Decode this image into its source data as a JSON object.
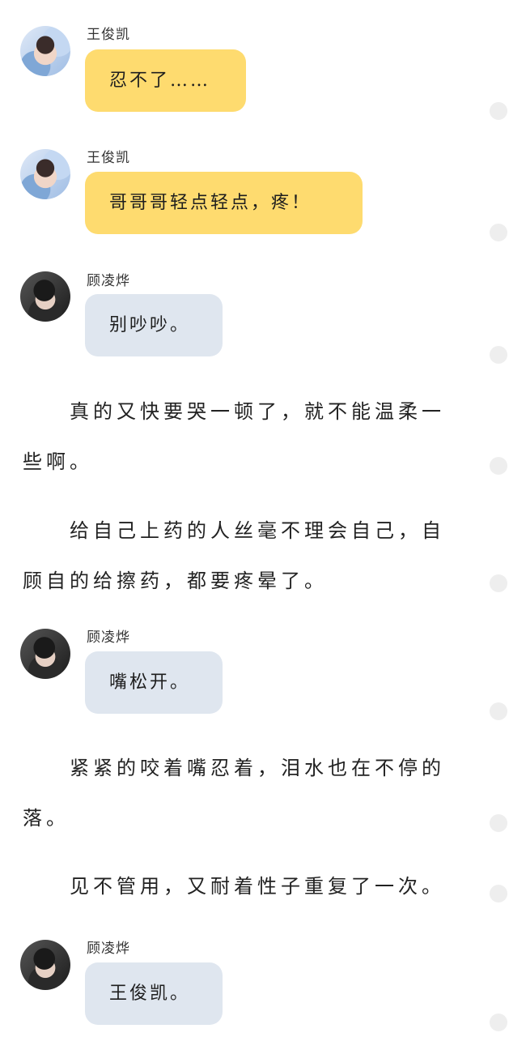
{
  "messages": [
    {
      "speaker": "王俊凯",
      "text": "忍不了……"
    },
    {
      "speaker": "王俊凯",
      "text": "哥哥哥轻点轻点，疼！"
    },
    {
      "speaker": "顾凌烨",
      "text": "别吵吵。"
    },
    {
      "speaker": "顾凌烨",
      "text": "嘴松开。"
    },
    {
      "speaker": "顾凌烨",
      "text": "王俊凯。"
    }
  ],
  "narration": [
    "真的又快要哭一顿了，就不能温柔一些啊。",
    "给自己上药的人丝毫不理会自己，自顾自的给擦药，都要疼晕了。",
    "紧紧的咬着嘴忍着，泪水也在不停的落。",
    "见不管用，又耐着性子重复了一次。"
  ]
}
